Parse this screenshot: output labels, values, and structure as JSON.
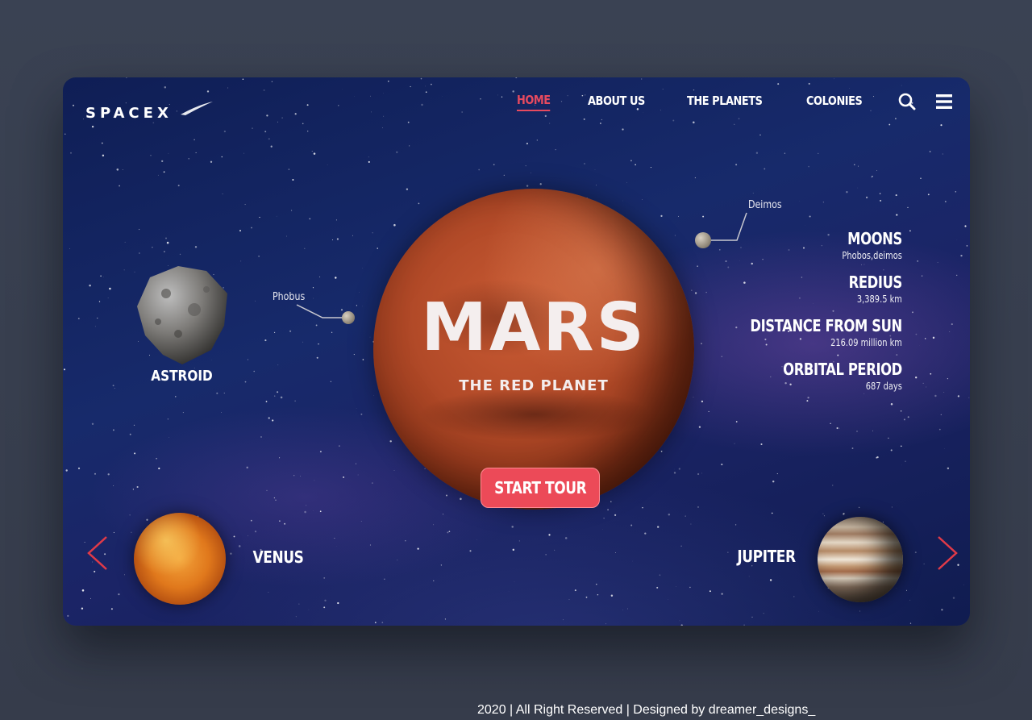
{
  "brand": {
    "logo_text": "SPACEX"
  },
  "nav": {
    "items": [
      {
        "label": "HOME",
        "active": true
      },
      {
        "label": "ABOUT US",
        "active": false
      },
      {
        "label": "THE PLANETS",
        "active": false
      },
      {
        "label": "COLONIES",
        "active": false
      }
    ],
    "icons": [
      "search-icon",
      "menu-icon"
    ]
  },
  "hero": {
    "title": "MARS",
    "subtitle": "THE RED PLANET",
    "cta_label": "START TOUR"
  },
  "asteroid": {
    "label": "ASTROID"
  },
  "moons": [
    {
      "name": "Phobus"
    },
    {
      "name": "Deimos"
    }
  ],
  "stats": [
    {
      "label": "MOONS",
      "value": "Phobos,deimos"
    },
    {
      "label": "REDIUS",
      "value": "3,389.5 km"
    },
    {
      "label": "DISTANCE FROM SUN",
      "value": "216.09 million km"
    },
    {
      "label": "ORBITAL PERIOD",
      "value": "687 days"
    }
  ],
  "carousel": {
    "prev_planet": "VENUS",
    "next_planet": "JUPITER"
  },
  "colors": {
    "accent": "#ec4a58",
    "background": "#383f4f",
    "text": "#ffffff"
  },
  "footer": {
    "text": "2020 | All Right Reserved | Designed by dreamer_designs_"
  }
}
